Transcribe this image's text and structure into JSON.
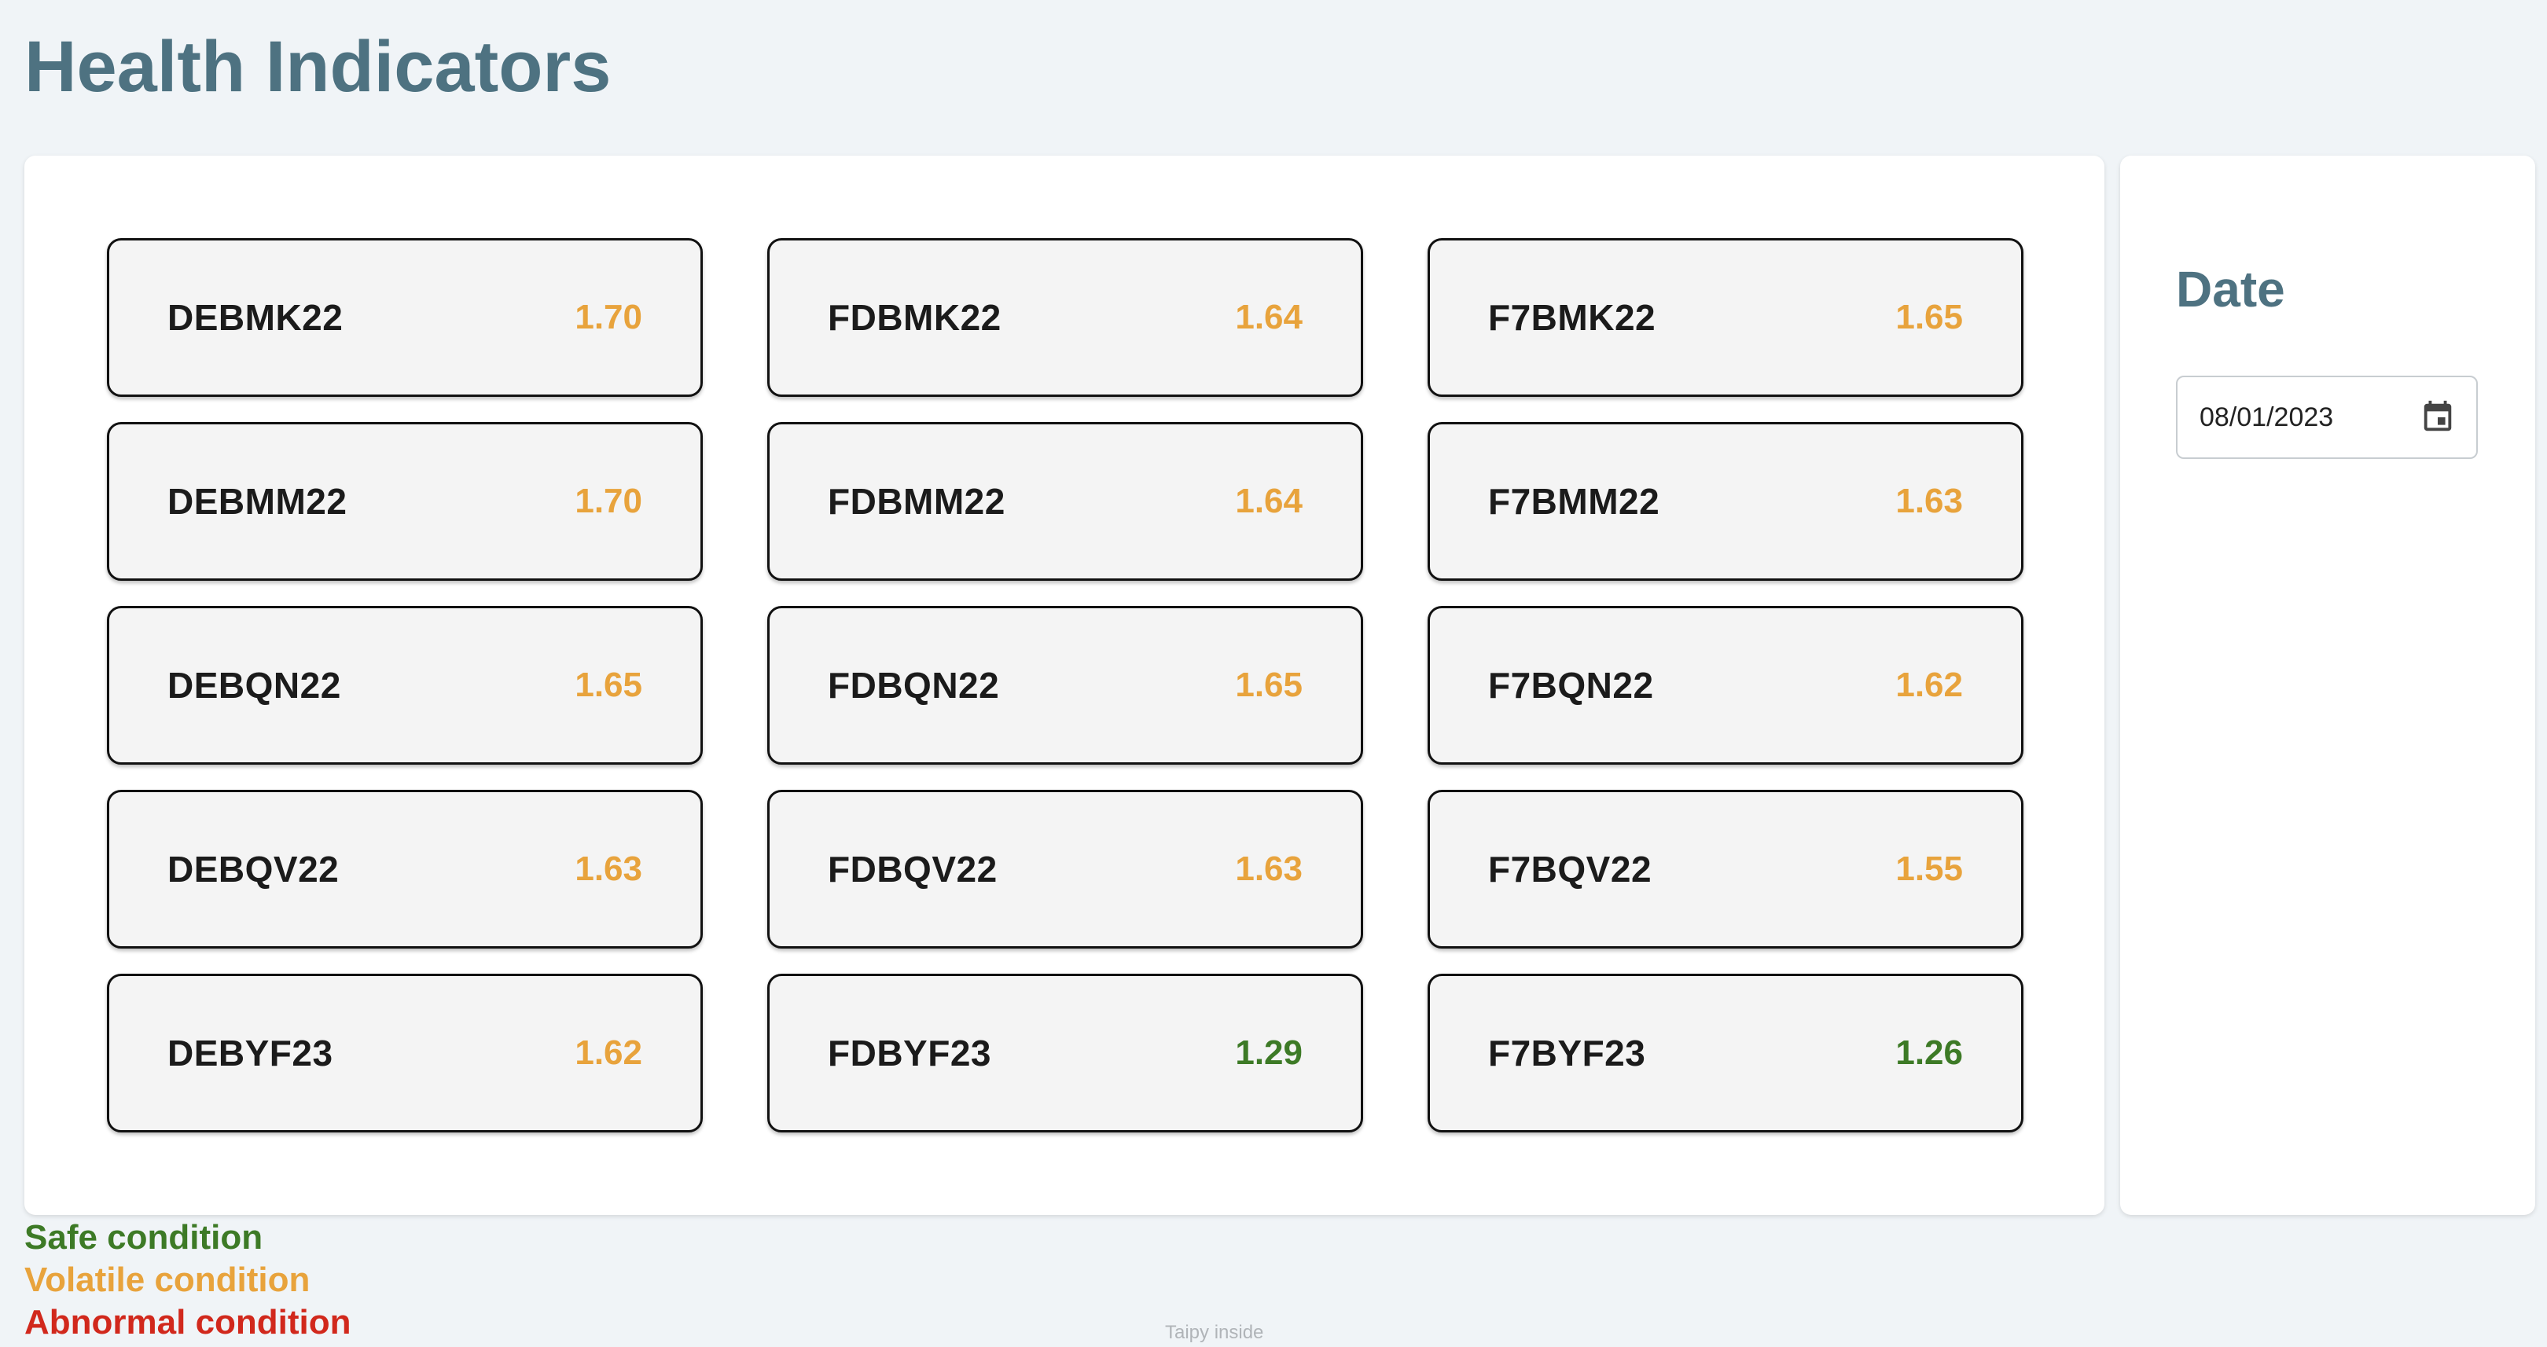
{
  "page_title": "Health Indicators",
  "colors": {
    "safe": "#3d7a26",
    "volatile": "#e8a33c",
    "abnormal": "#d1281c"
  },
  "indicators": [
    {
      "name": "DEBMK22",
      "value": "1.70",
      "status": "volatile"
    },
    {
      "name": "FDBMK22",
      "value": "1.64",
      "status": "volatile"
    },
    {
      "name": "F7BMK22",
      "value": "1.65",
      "status": "volatile"
    },
    {
      "name": "DEBMM22",
      "value": "1.70",
      "status": "volatile"
    },
    {
      "name": "FDBMM22",
      "value": "1.64",
      "status": "volatile"
    },
    {
      "name": "F7BMM22",
      "value": "1.63",
      "status": "volatile"
    },
    {
      "name": "DEBQN22",
      "value": "1.65",
      "status": "volatile"
    },
    {
      "name": "FDBQN22",
      "value": "1.65",
      "status": "volatile"
    },
    {
      "name": "F7BQN22",
      "value": "1.62",
      "status": "volatile"
    },
    {
      "name": "DEBQV22",
      "value": "1.63",
      "status": "volatile"
    },
    {
      "name": "FDBQV22",
      "value": "1.63",
      "status": "volatile"
    },
    {
      "name": "F7BQV22",
      "value": "1.55",
      "status": "volatile"
    },
    {
      "name": "DEBYF23",
      "value": "1.62",
      "status": "volatile"
    },
    {
      "name": "FDBYF23",
      "value": "1.29",
      "status": "safe"
    },
    {
      "name": "F7BYF23",
      "value": "1.26",
      "status": "safe"
    }
  ],
  "date_panel": {
    "label": "Date",
    "value": "08/01/2023",
    "icon": "calendar-icon"
  },
  "legend": [
    {
      "label": "Safe condition",
      "status": "safe"
    },
    {
      "label": "Volatile condition",
      "status": "volatile"
    },
    {
      "label": "Abnormal condition",
      "status": "abnormal"
    }
  ],
  "footer": "Taipy inside"
}
